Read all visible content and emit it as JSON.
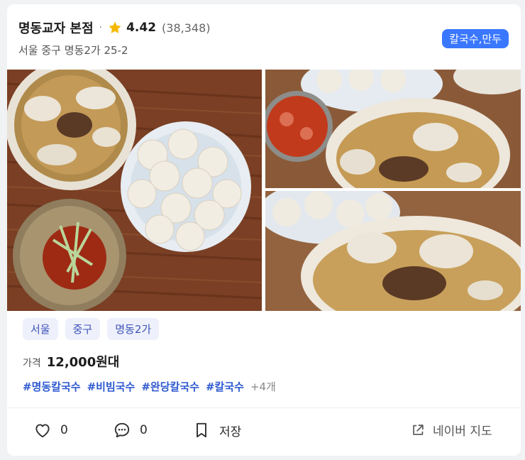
{
  "restaurant": {
    "name": "명동교자 본점",
    "separator": "·",
    "rating": "4.42",
    "review_count": "(38,348)",
    "address": "서울 중구 명동2가 25-2",
    "category_badge": "칼국수,만두"
  },
  "photos": [
    {
      "icon": "food-photo-main"
    },
    {
      "icon": "food-photo-top-right"
    },
    {
      "icon": "food-photo-bottom-right"
    }
  ],
  "location_tags": [
    "서울",
    "중구",
    "명동2가"
  ],
  "price": {
    "label": "가격",
    "value": "12,000원대"
  },
  "hashtags": [
    "#명동칼국수",
    "#비빔국수",
    "#완당칼국수",
    "#칼국수"
  ],
  "hashtags_more": "+4개",
  "actions": {
    "like_count": "0",
    "comment_count": "0",
    "save_label": "저장",
    "map_label": "네이버 지도"
  },
  "colors": {
    "badge_bg": "#3a77ff",
    "tag_bg": "#eef0fb",
    "tag_text": "#3e54b8",
    "hashtag": "#2f5bd1",
    "star": "#f5b800"
  }
}
